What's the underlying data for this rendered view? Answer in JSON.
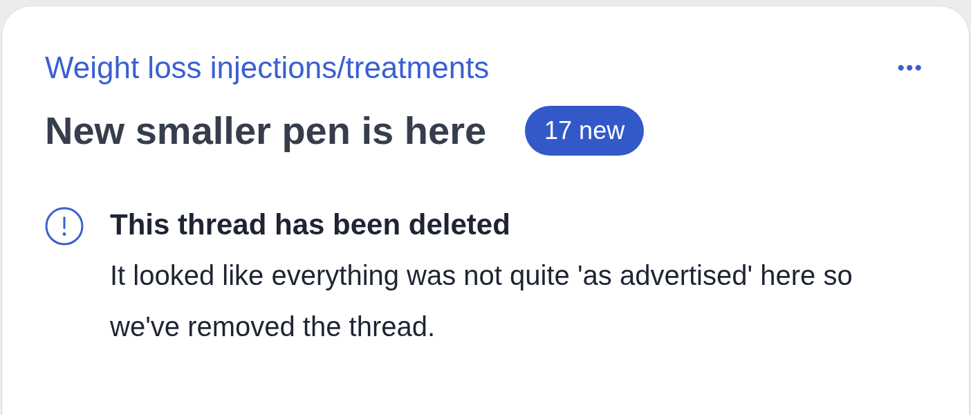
{
  "category": "Weight loss injections/treatments",
  "menu": {
    "label": "•••"
  },
  "title": "New smaller pen is here",
  "badge": "17 new",
  "notice": {
    "kind": "warning",
    "heading": "This thread has been deleted",
    "body": "It looked like everything was not quite 'as advertised' here so we've removed the thread."
  }
}
